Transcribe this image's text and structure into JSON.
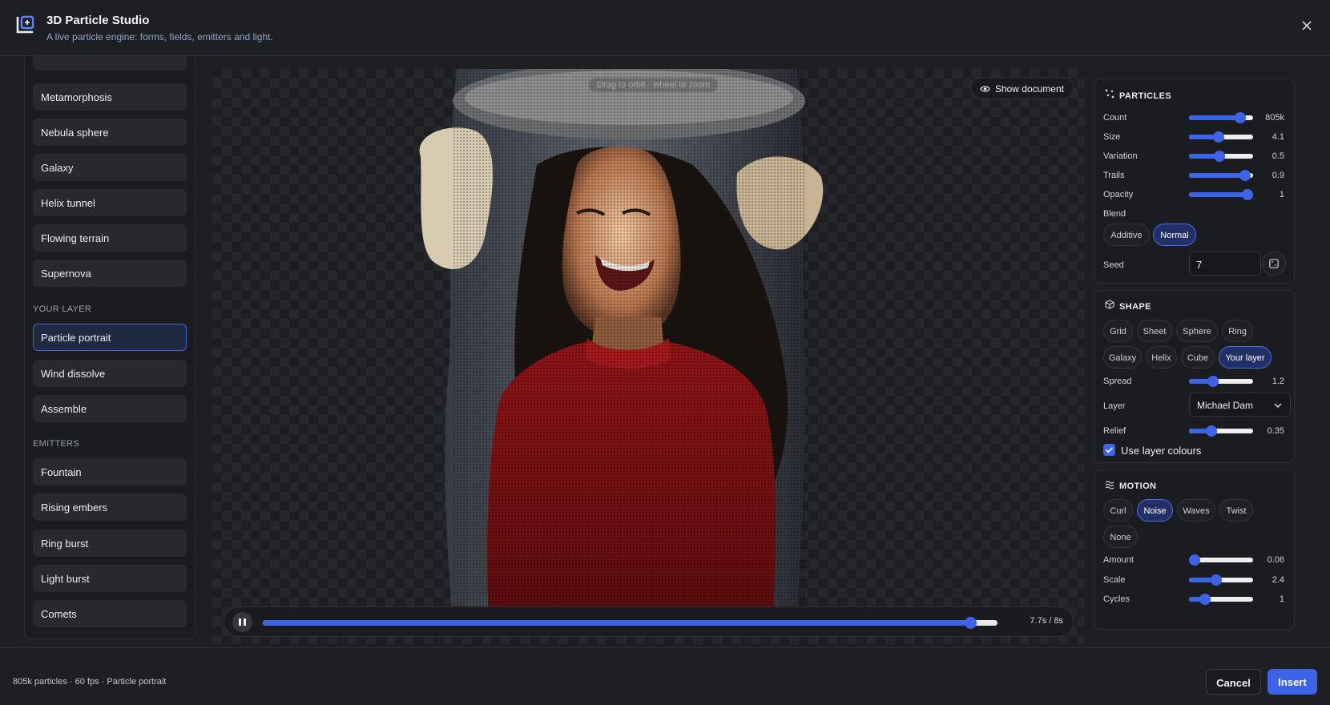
{
  "header": {
    "title": "3D Particle Studio",
    "subtitle": "A live particle engine: forms, fields, emitters and light."
  },
  "sidebar": {
    "forms": [
      "Metamorphosis",
      "Nebula sphere",
      "Galaxy",
      "Helix tunnel",
      "Flowing terrain",
      "Supernova"
    ],
    "your_layer_heading": "YOUR LAYER",
    "your_layer": [
      "Particle portrait",
      "Wind dissolve",
      "Assemble"
    ],
    "emitters_heading": "EMITTERS",
    "emitters": [
      "Fountain",
      "Rising embers",
      "Ring burst",
      "Light burst",
      "Comets"
    ],
    "active": "Particle portrait"
  },
  "canvas": {
    "hint": "Drag to orbit · wheel to zoom",
    "show_document": "Show document"
  },
  "player": {
    "time": "7.7s / 8s",
    "progress": 0.9625
  },
  "particles": {
    "heading": "PARTICLES",
    "count": {
      "label": "Count",
      "value": "805k",
      "level": 0.8
    },
    "size": {
      "label": "Size",
      "value": "4.1",
      "level": 0.46
    },
    "variation": {
      "label": "Variation",
      "value": "0.5",
      "level": 0.48
    },
    "trails": {
      "label": "Trails",
      "value": "0.9",
      "level": 0.88
    },
    "opacity": {
      "label": "Opacity",
      "value": "1",
      "level": 1.0
    },
    "blend_label": "Blend",
    "blend_options": [
      "Additive",
      "Normal"
    ],
    "blend_selected": "Normal",
    "seed_label": "Seed",
    "seed_value": "7"
  },
  "shape": {
    "heading": "SHAPE",
    "options": [
      "Grid",
      "Sheet",
      "Sphere",
      "Ring",
      "Galaxy",
      "Helix",
      "Cube",
      "Your layer"
    ],
    "selected": "Your layer",
    "spread": {
      "label": "Spread",
      "value": "1.2",
      "level": 0.38
    },
    "layer_label": "Layer",
    "layer_value": "Michael Dam",
    "relief": {
      "label": "Relief",
      "value": "0.35",
      "level": 0.35
    },
    "use_layer_colours": "Use layer colours"
  },
  "motion": {
    "heading": "MOTION",
    "options": [
      "Curl",
      "Noise",
      "Waves",
      "Twist",
      "None"
    ],
    "selected": "Noise",
    "amount": {
      "label": "Amount",
      "value": "0.06",
      "level": 0.04
    },
    "scale": {
      "label": "Scale",
      "value": "2.4",
      "level": 0.42
    },
    "cycles": {
      "label": "Cycles",
      "value": "1",
      "level": 0.25
    }
  },
  "footer": {
    "status": "805k particles · 60 fps · Particle portrait",
    "cancel": "Cancel",
    "insert": "Insert"
  },
  "colors": {
    "accent": "#3d63e8",
    "background": "#1e1f23",
    "panel": "#1b1c20"
  }
}
